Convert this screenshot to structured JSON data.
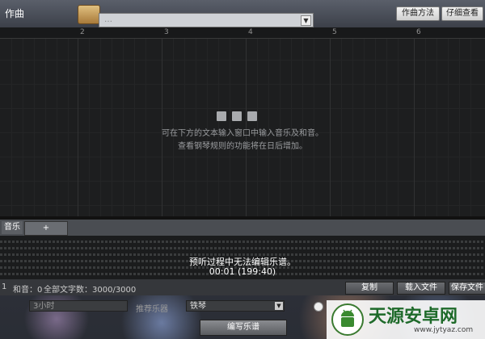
{
  "window": {
    "title": "作曲"
  },
  "header": {
    "combo_text": "…",
    "buttons": {
      "compose_method": "作曲方法",
      "view_details": "仔细查看"
    }
  },
  "grid": {
    "ruler_numbers": [
      "2",
      "3",
      "4",
      "5",
      "6"
    ],
    "hint_line1": "可在下方的文本输入窗口中输入音乐及和音。",
    "hint_line2": "查看钢琴规则的功能将在日后增加。"
  },
  "tabs": {
    "active": "音乐",
    "add": "+"
  },
  "preview": {
    "message": "预听过程中无法编辑乐谱。",
    "time": "00:01 (199:40)"
  },
  "status": {
    "left_count": "1",
    "chord_label": "和音：0",
    "char_count": "全部文字数：3000/3000",
    "buttons": {
      "copy": "复制",
      "load": "载入文件",
      "save": "保存文件"
    }
  },
  "bottom": {
    "name_field": "3小时",
    "recommended_label": "推荐乐器",
    "instrument": "铁琴",
    "compose_button": "编写乐谱"
  },
  "watermark": {
    "title": "天源安卓网",
    "url": "www.jytyaz.com"
  }
}
